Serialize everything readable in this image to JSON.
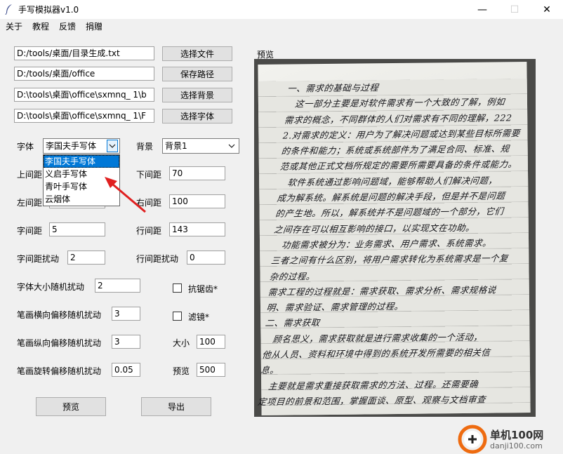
{
  "window": {
    "title": "手写模拟器v1.0",
    "minimize": "—",
    "maximize": "☐",
    "close": "✕"
  },
  "menu": [
    "关于",
    "教程",
    "反馈",
    "捐赠"
  ],
  "files": {
    "text_path": "D:/tools/桌面/目录生成.txt",
    "save_path": "D:/tools/桌面/office",
    "bg_path": "D:\\tools\\桌面\\office\\sxmnq_   1\\b",
    "font_path": "D:\\tools\\桌面\\office\\sxmnq_   1\\F",
    "choose_file": "选择文件",
    "save_dir": "保存路径",
    "choose_bg": "选择背景",
    "choose_font": "选择字体"
  },
  "font": {
    "label": "字体",
    "selected": "李国夫手写体",
    "options": [
      "李国夫手写体",
      "义启手写体",
      "青叶手写体",
      "云烟体"
    ]
  },
  "background": {
    "label": "背景",
    "selected": "背景1"
  },
  "params": {
    "top_margin": {
      "label": "上间距",
      "value": ""
    },
    "bottom_margin": {
      "label": "下间距",
      "value": "70"
    },
    "left_margin": {
      "label": "左间距",
      "value": ""
    },
    "right_margin": {
      "label": "右间距",
      "value": "100"
    },
    "char_spacing": {
      "label": "字间距",
      "value": "5"
    },
    "line_spacing": {
      "label": "行间距",
      "value": "143"
    },
    "char_jitter": {
      "label": "字间距扰动",
      "value": "2"
    },
    "line_jitter": {
      "label": "行间距扰动",
      "value": "0"
    },
    "size_jitter": {
      "label": "字体大小随机扰动",
      "value": "2"
    },
    "h_offset": {
      "label": "笔画横向偏移随机扰动",
      "value": "3"
    },
    "v_offset": {
      "label": "笔画纵向偏移随机扰动",
      "value": "3"
    },
    "rotation": {
      "label": "笔画旋转偏移随机扰动",
      "value": "0.05"
    },
    "size": {
      "label": "大小",
      "value": "100"
    },
    "preview_size": {
      "label": "预览",
      "value": "500"
    }
  },
  "options": {
    "antialias": "抗锯齿*",
    "filter": "滤镜*"
  },
  "buttons": {
    "preview": "预览",
    "export": "导出"
  },
  "preview": {
    "label": "预览",
    "lines": [
      "一、需求的基础与过程",
      "　这一部分主要是对软件需求有一个大致的了解，例如",
      "需求的概念，不同群体的人们对需求有不同的理解，222",
      "2.对需求的定义：用户为了解决问题或达到某些目标所需要",
      "的条件和能力；系统或系统部件为了满足合同、标准、规",
      "范或其他正式文档所规定的需要所需要具备的条件或能力。",
      "　软件系统通过影响问题域，能够帮助人们解决问题，",
      "成为解系统。解系统是问题的解决手段，但是并不是问题",
      "的产生地。所以，解系统并不是问题域的一个部分，它们",
      "之间存在可以相互影响的接口，以实现文在功助。",
      "　功能需求被分为：业务需求、用户需求、系统需求。",
      "三者之间有什么区别，将用户需求转化为系统需求是一个复",
      "杂的过程。",
      "需求工程的过程就是：需求获取、需求分析、需求规格说",
      "明、需求验证、需求管理的过程。",
      "二、需求获取",
      "　顾名思义，需求获取就是进行需求收集的一个活动，",
      "他从人员、资料和环境中得到的系统开发所需要的相关信",
      "息。",
      "　主要就是需求重接获取需求的方法、过程。还需要确",
      "定项目的前景和范围，掌握面谈、原型、观察与文档审查"
    ]
  },
  "watermark": {
    "name": "单机100网",
    "url": "danji100.com"
  },
  "colors": {
    "selection": "#0078d7",
    "arrow": "#e02020",
    "watermark": "#ee6b10"
  }
}
